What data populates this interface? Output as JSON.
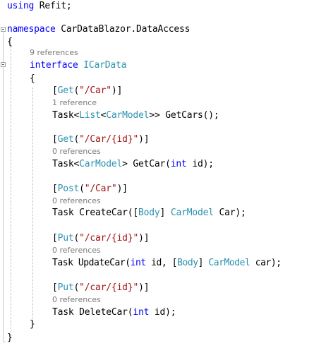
{
  "code": {
    "l1": {
      "kw": "using",
      "rest": " Refit;"
    },
    "l3": {
      "kw": "namespace",
      "rest": " CarDataBlazor.DataAccess"
    },
    "l4": {
      "text": "{"
    },
    "lens_interface": "9 references",
    "l5": {
      "kw": "interface",
      "type": "ICarData"
    },
    "l6": {
      "text": "{"
    },
    "m1": {
      "attr": "Get",
      "route": "\"/Car\"",
      "lens": "1 reference",
      "sig_a": "Task<",
      "sig_list": "List",
      "sig_b": "<",
      "sig_model": "CarModel",
      "sig_c": ">> GetCars();"
    },
    "m2": {
      "attr": "Get",
      "route": "\"/Car/{id}\"",
      "lens": "0 references",
      "sig_a": "Task<",
      "sig_model": "CarModel",
      "sig_b": "> GetCar(",
      "sig_kw": "int",
      "sig_c": " id);"
    },
    "m3": {
      "attr": "Post",
      "route": "\"/Car\"",
      "lens": "0 references",
      "sig_a": "Task CreateCar([",
      "sig_body": "Body",
      "sig_b": "] ",
      "sig_model": "CarModel",
      "sig_c": " Car);"
    },
    "m4": {
      "attr": "Put",
      "route": "\"/car/{id}\"",
      "lens": "0 references",
      "sig_a": "Task UpdateCar(",
      "sig_kw": "int",
      "sig_b": " id, [",
      "sig_body": "Body",
      "sig_c": "] ",
      "sig_model": "CarModel",
      "sig_d": " car);"
    },
    "m5": {
      "attr": "Put",
      "route": "\"/car/{id}\"",
      "lens": "0 references",
      "sig_a": "Task DeleteCar(",
      "sig_kw": "int",
      "sig_b": " id);"
    },
    "close_interface": "}",
    "close_namespace": "}",
    "punct": {
      "open_attr": "[",
      "open_paren": "(",
      "close_attr": ")]"
    }
  },
  "colors": {
    "keyword": "#0000ff",
    "type": "#2b91af",
    "string": "#a31515",
    "lens": "#7a7a7a"
  }
}
